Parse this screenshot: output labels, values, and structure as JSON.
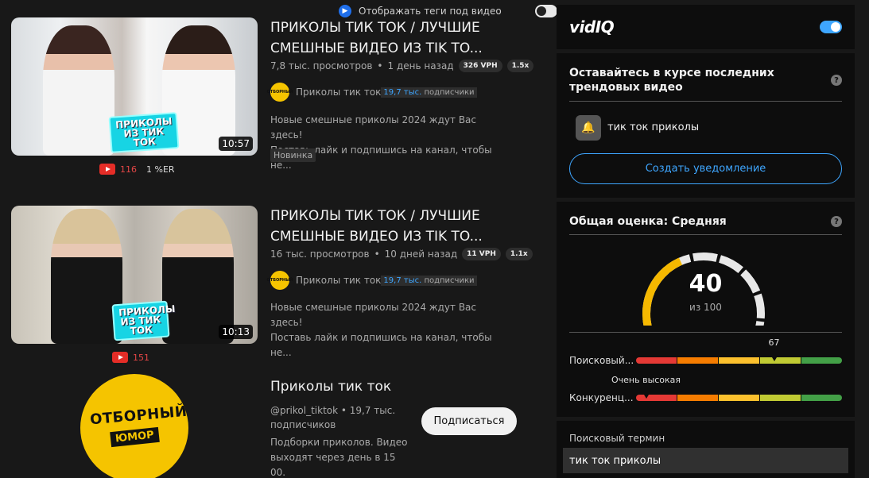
{
  "top_toggle": {
    "label": "Отображать теги под видео",
    "enabled": false
  },
  "videos": [
    {
      "title": "ПРИКОЛЫ ТИК ТОК / ЛУЧШИЕ СМЕШНЫЕ ВИДЕО ИЗ TIK TO...",
      "views": "7,8 тыс. просмотров",
      "age": "1 день назад",
      "vph": "326 VPH",
      "multiplier": "1.5x",
      "channel": "Приколы тик ток",
      "subs_num": "19,7 тыс.",
      "subs_word": "подписчики",
      "desc_line1": "Новые смешные приколы 2024 ждут Вас здесь!",
      "desc_line2": "Поставь лайк и подпишись на канал, чтобы не...",
      "badge": "Новинка",
      "thumb_text": "ПРИКОЛЫ ИЗ ТИК ТОК",
      "duration": "10:57",
      "likes": "116",
      "er": "1 %ER"
    },
    {
      "title": "ПРИКОЛЫ ТИК ТОК / ЛУЧШИЕ СМЕШНЫЕ ВИДЕО ИЗ TIK TO...",
      "views": "16 тыс. просмотров",
      "age": "10 дней назад",
      "vph": "11 VPH",
      "multiplier": "1.1x",
      "channel": "Приколы тик ток",
      "subs_num": "19,7 тыс.",
      "subs_word": "подписчики",
      "desc_line1": "Новые смешные приколы 2024 ждут Вас здесь!",
      "desc_line2": "Поставь лайк и подпишись на канал, чтобы не...",
      "thumb_text": "ПРИКОЛЫ ИЗ ТИК ТОК",
      "duration": "10:13",
      "likes": "151"
    }
  ],
  "channel_card": {
    "avatar_line1": "ОТБОРНЫЙ",
    "avatar_line2": "ЮМОР",
    "name": "Приколы тик ток",
    "handle_line": "@prikol_tiktok • 19,7 тыс. подписчиков",
    "description": "Подборки приколов. Видео выходят через день в 15 00.",
    "subscribe_label": "Подписаться"
  },
  "vidiq": {
    "logo": "vidIQ",
    "enabled": true,
    "trend": {
      "heading": "Оставайтесь в курсе последних трендовых видео",
      "keyword": "тик ток приколы",
      "button": "Создать уведомление"
    },
    "score": {
      "heading": "Общая оценка: Средняя",
      "value": "40",
      "out_of": "из 100",
      "score_fraction": 0.4,
      "search_label": "Поисковый...",
      "search_value": "67",
      "search_fraction": 0.67,
      "competition_label": "Конкуренц...",
      "competition_tip": "Очень высокая",
      "competition_fraction": 0.05,
      "bar_colors": [
        "#e53935",
        "#f57c00",
        "#fbc02d",
        "#c0ca33",
        "#43a047"
      ]
    },
    "term": {
      "label": "Поисковый термин",
      "value": "тик ток приколы"
    }
  },
  "colors": {
    "accent": "#3ea6ff",
    "gauge": "#f5b800",
    "youtube_red": "#e52d27"
  }
}
